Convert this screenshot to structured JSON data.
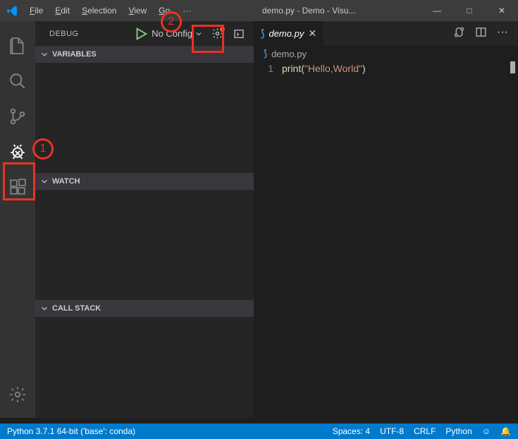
{
  "titlebar": {
    "menu": {
      "file": "File",
      "edit": "Edit",
      "selection": "Selection",
      "view": "View",
      "go": "Go",
      "more": "···"
    },
    "title": "demo.py - Demo - Visu...",
    "win": {
      "min": "—",
      "max": "□",
      "close": "✕"
    }
  },
  "sidebar": {
    "header": {
      "label": "DEBUG",
      "config": "No Config"
    },
    "sections": {
      "variables": "VARIABLES",
      "watch": "WATCH",
      "callstack": "CALL STACK"
    }
  },
  "editor": {
    "tab": {
      "filename": "demo.py",
      "close": "✕"
    },
    "crumb": {
      "filename": "demo.py"
    },
    "line": {
      "num": "1",
      "fn": "print",
      "p1": "(",
      "str": "\"Hello,World\"",
      "p2": ")"
    }
  },
  "status": {
    "left": "Python 3.7.1 64-bit ('base': conda)",
    "spaces": "Spaces: 4",
    "enc": "UTF-8",
    "eol": "CRLF",
    "lang": "Python",
    "face": "☺",
    "bell": "🔔"
  },
  "anno": {
    "n1": "1",
    "n2": "2"
  }
}
